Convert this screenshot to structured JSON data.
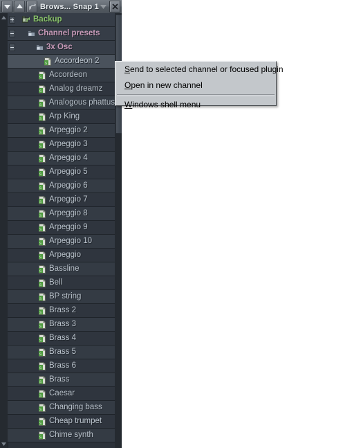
{
  "window": {
    "title": "Brows... Snap 1",
    "buttons": {
      "down": "down-arrow",
      "up": "up-arrow",
      "back": "back-arrow",
      "menu_caret": "chevron-down-icon",
      "close": "×"
    }
  },
  "tree": {
    "nodes": [
      {
        "label": "Backup",
        "kind": "folder-green",
        "indent": 10,
        "style": "green",
        "bg": "hdr",
        "toggle": "plus"
      },
      {
        "label": "Channel presets",
        "kind": "folder",
        "indent": 18,
        "style": "mauve",
        "bg": "hdr",
        "toggle": "minus"
      },
      {
        "label": "3x Osc",
        "kind": "folder",
        "indent": 30,
        "style": "mauve",
        "bg": "hdr",
        "toggle": "minus"
      },
      {
        "label": "Accordeon 2",
        "kind": "file",
        "indent": 42,
        "style": "sel",
        "bg": "sel",
        "toggle": "none"
      },
      {
        "label": "Accordeon",
        "kind": "file",
        "indent": 34,
        "style": "item",
        "bg": "norm",
        "toggle": "none"
      },
      {
        "label": "Analog dreamz",
        "kind": "file",
        "indent": 34,
        "style": "item",
        "bg": "dark",
        "toggle": "none"
      },
      {
        "label": "Analogous phattus",
        "kind": "file",
        "indent": 34,
        "style": "item",
        "bg": "norm",
        "toggle": "none"
      },
      {
        "label": "Arp King",
        "kind": "file",
        "indent": 34,
        "style": "item",
        "bg": "dark",
        "toggle": "none"
      },
      {
        "label": "Arpeggio 2",
        "kind": "file",
        "indent": 34,
        "style": "item",
        "bg": "norm",
        "toggle": "none"
      },
      {
        "label": "Arpeggio 3",
        "kind": "file",
        "indent": 34,
        "style": "item",
        "bg": "dark",
        "toggle": "none"
      },
      {
        "label": "Arpeggio 4",
        "kind": "file",
        "indent": 34,
        "style": "item",
        "bg": "norm",
        "toggle": "none"
      },
      {
        "label": "Arpeggio 5",
        "kind": "file",
        "indent": 34,
        "style": "item",
        "bg": "dark",
        "toggle": "none"
      },
      {
        "label": "Arpeggio 6",
        "kind": "file",
        "indent": 34,
        "style": "item",
        "bg": "norm",
        "toggle": "none"
      },
      {
        "label": "Arpeggio 7",
        "kind": "file",
        "indent": 34,
        "style": "item",
        "bg": "dark",
        "toggle": "none"
      },
      {
        "label": "Arpeggio 8",
        "kind": "file",
        "indent": 34,
        "style": "item",
        "bg": "norm",
        "toggle": "none"
      },
      {
        "label": "Arpeggio 9",
        "kind": "file",
        "indent": 34,
        "style": "item",
        "bg": "dark",
        "toggle": "none"
      },
      {
        "label": "Arpeggio 10",
        "kind": "file",
        "indent": 34,
        "style": "item",
        "bg": "norm",
        "toggle": "none"
      },
      {
        "label": "Arpeggio",
        "kind": "file",
        "indent": 34,
        "style": "item",
        "bg": "dark",
        "toggle": "none"
      },
      {
        "label": "Bassline",
        "kind": "file",
        "indent": 34,
        "style": "item",
        "bg": "norm",
        "toggle": "none"
      },
      {
        "label": "Bell",
        "kind": "file",
        "indent": 34,
        "style": "item",
        "bg": "dark",
        "toggle": "none"
      },
      {
        "label": "BP string",
        "kind": "file",
        "indent": 34,
        "style": "item",
        "bg": "norm",
        "toggle": "none"
      },
      {
        "label": "Brass 2",
        "kind": "file",
        "indent": 34,
        "style": "item",
        "bg": "dark",
        "toggle": "none"
      },
      {
        "label": "Brass 3",
        "kind": "file",
        "indent": 34,
        "style": "item",
        "bg": "norm",
        "toggle": "none"
      },
      {
        "label": "Brass 4",
        "kind": "file",
        "indent": 34,
        "style": "item",
        "bg": "dark",
        "toggle": "none"
      },
      {
        "label": "Brass 5",
        "kind": "file",
        "indent": 34,
        "style": "item",
        "bg": "norm",
        "toggle": "none"
      },
      {
        "label": "Brass 6",
        "kind": "file",
        "indent": 34,
        "style": "item",
        "bg": "dark",
        "toggle": "none"
      },
      {
        "label": "Brass",
        "kind": "file",
        "indent": 34,
        "style": "item",
        "bg": "norm",
        "toggle": "none"
      },
      {
        "label": "Caesar",
        "kind": "file",
        "indent": 34,
        "style": "item",
        "bg": "dark",
        "toggle": "none"
      },
      {
        "label": "Changing bass",
        "kind": "file",
        "indent": 34,
        "style": "item",
        "bg": "norm",
        "toggle": "none"
      },
      {
        "label": "Cheap trumpet",
        "kind": "file",
        "indent": 34,
        "style": "item",
        "bg": "dark",
        "toggle": "none"
      },
      {
        "label": "Chime synth",
        "kind": "file",
        "indent": 34,
        "style": "item",
        "bg": "norm",
        "toggle": "none"
      }
    ]
  },
  "context_menu": {
    "items": [
      {
        "accel": "S",
        "rest": "end to selected channel or focused plugin",
        "separator_before": false
      },
      {
        "accel": "O",
        "rest": "pen in new channel",
        "separator_before": false
      },
      {
        "accel": "W",
        "rest": "indows shell menu",
        "separator_before": true
      }
    ]
  },
  "colors": {
    "panel_bg": "#2b3139",
    "row_bg": "#343b44",
    "row_bg_alt": "#2f353e",
    "row_selected": "#4a525c",
    "text_item": "#b9c2cb",
    "text_folder": "#c89ab8",
    "text_root": "#8ac46a",
    "menu_bg": "#c3c7cb",
    "page_bg": "#ffffff"
  }
}
